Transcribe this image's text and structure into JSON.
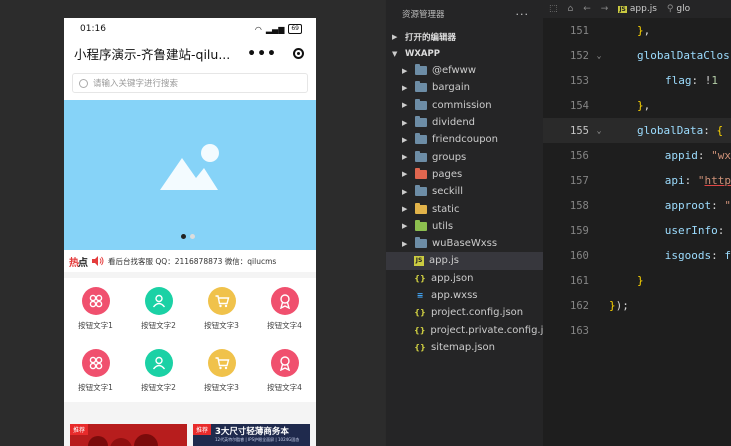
{
  "simulator": {
    "status_time": "01:16",
    "battery": "69",
    "nav_title": "小程序演示-齐鲁建站-qilu...",
    "search_placeholder": "请输入关键字进行搜索",
    "notice_brand_a": "热",
    "notice_brand_b": "点",
    "notice_text": "看后台找客服 QQ：2116878873 微信：qilucms",
    "grid_items": [
      {
        "label": "按钮文字1",
        "color": "#f0506e",
        "icon": "share-icon"
      },
      {
        "label": "按钮文字2",
        "color": "#1bd1a5",
        "icon": "user-icon"
      },
      {
        "label": "按钮文字3",
        "color": "#f0c24b",
        "icon": "cart-icon"
      },
      {
        "label": "按钮文字4",
        "color": "#f0506e",
        "icon": "award-icon"
      },
      {
        "label": "按钮文字1",
        "color": "#f0506e",
        "icon": "share-icon"
      },
      {
        "label": "按钮文字2",
        "color": "#1bd1a5",
        "icon": "user-icon"
      },
      {
        "label": "按钮文字3",
        "color": "#f0c24b",
        "icon": "cart-icon"
      },
      {
        "label": "按钮文字4",
        "color": "#f0506e",
        "icon": "award-icon"
      }
    ],
    "promo_tag": "推荐",
    "promo_title": "3大尺寸轻薄商务本",
    "promo_sub": "12代英特尔酷睿 | IPS护眼全面屏 | 1024G固态"
  },
  "explorer": {
    "title": "资源管理器",
    "menu": "···",
    "open_editors": "打开的编辑器",
    "project": "WXAPP",
    "folders": [
      {
        "name": "@efwww",
        "color": "#6d8da6"
      },
      {
        "name": "bargain",
        "color": "#6d8da6"
      },
      {
        "name": "commission",
        "color": "#6d8da6"
      },
      {
        "name": "dividend",
        "color": "#6d8da6"
      },
      {
        "name": "friendcoupon",
        "color": "#6d8da6"
      },
      {
        "name": "groups",
        "color": "#6d8da6"
      },
      {
        "name": "pages",
        "color": "#e0664f"
      },
      {
        "name": "seckill",
        "color": "#6d8da6"
      },
      {
        "name": "static",
        "color": "#e2b34a"
      },
      {
        "name": "utils",
        "color": "#8cbf4f"
      },
      {
        "name": "wuBaseWxss",
        "color": "#6d8da6"
      }
    ],
    "files": [
      {
        "name": "app.js",
        "glyph": "JS",
        "color": "#cbcb41",
        "selected": true
      },
      {
        "name": "app.json",
        "glyph": "{}",
        "color": "#cbcb41",
        "selected": false
      },
      {
        "name": "app.wxss",
        "glyph": "≡",
        "color": "#42a5f5",
        "selected": false
      },
      {
        "name": "project.config.json",
        "glyph": "{}",
        "color": "#cbcb41",
        "selected": false
      },
      {
        "name": "project.private.config.js...",
        "glyph": "{}",
        "color": "#cbcb41",
        "selected": false
      },
      {
        "name": "sitemap.json",
        "glyph": "{}",
        "color": "#cbcb41",
        "selected": false
      }
    ]
  },
  "editor": {
    "tab_file": "app.js",
    "tab_more": "glo",
    "lines": [
      {
        "num": "151",
        "text": "},"
      },
      {
        "num": "152",
        "text": "globalDataClos"
      },
      {
        "num": "153",
        "text": "flag: !1"
      },
      {
        "num": "154",
        "text": "},"
      },
      {
        "num": "155",
        "text": "globalData: {"
      },
      {
        "num": "156",
        "text": "appid: \"wx"
      },
      {
        "num": "157",
        "text": "api: \"http"
      },
      {
        "num": "158",
        "text": "approot: \""
      },
      {
        "num": "159",
        "text": "userInfo:"
      },
      {
        "num": "160",
        "text": "isgoods: f"
      },
      {
        "num": "161",
        "text": "}"
      },
      {
        "num": "162",
        "text": "});"
      },
      {
        "num": "163",
        "text": ""
      }
    ]
  }
}
